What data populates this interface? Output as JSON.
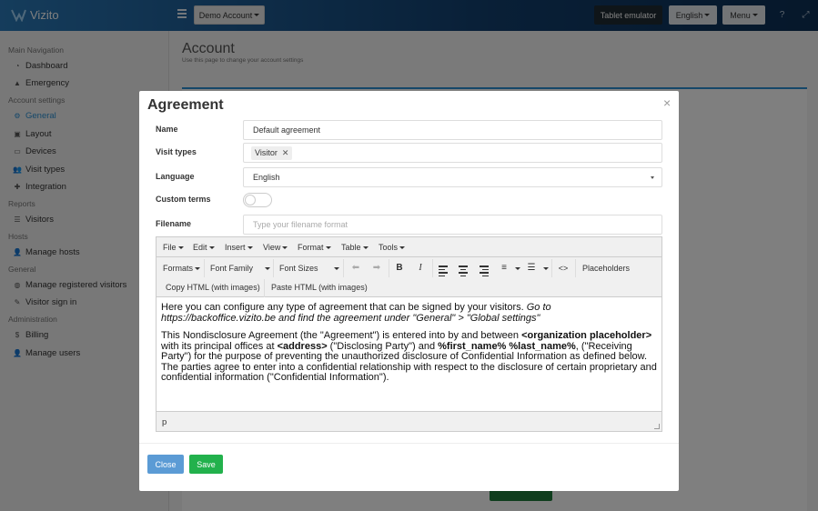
{
  "app": {
    "name": "Vizito"
  },
  "topbar": {
    "account_button": "Demo Account",
    "tablet_button": "Tablet emulator",
    "language_button": "English",
    "menu_button": "Menu"
  },
  "sidebar": {
    "sections": [
      {
        "title": "Main Navigation",
        "items": [
          {
            "label": "Dashboard",
            "icon": "dashboard-icon"
          },
          {
            "label": "Emergency",
            "icon": "warning-icon"
          }
        ]
      },
      {
        "title": "Account settings",
        "items": [
          {
            "label": "General",
            "icon": "gear-icon",
            "active": true
          },
          {
            "label": "Layout",
            "icon": "image-icon"
          },
          {
            "label": "Devices",
            "icon": "tablet-icon"
          },
          {
            "label": "Visit types",
            "icon": "users-icon"
          },
          {
            "label": "Integration",
            "icon": "puzzle-icon"
          }
        ]
      },
      {
        "title": "Reports",
        "items": [
          {
            "label": "Visitors",
            "icon": "list-icon"
          }
        ]
      },
      {
        "title": "Hosts",
        "items": [
          {
            "label": "Manage hosts",
            "icon": "user-plus-icon"
          }
        ]
      },
      {
        "title": "General",
        "items": [
          {
            "label": "Manage registered visitors",
            "icon": "globe-icon"
          },
          {
            "label": "Visitor sign in",
            "icon": "pen-icon"
          }
        ]
      },
      {
        "title": "Administration",
        "items": [
          {
            "label": "Billing",
            "icon": "dollar-icon"
          },
          {
            "label": "Manage users",
            "icon": "user-add-icon"
          }
        ]
      }
    ]
  },
  "page": {
    "title": "Account",
    "subtitle": "Use this page to change your account settings"
  },
  "modal": {
    "title": "Agreement",
    "close_glyph": "×",
    "fields": {
      "name_label": "Name",
      "name_value": "Default agreement",
      "visit_types_label": "Visit types",
      "visit_type_chip": "Visitor",
      "language_label": "Language",
      "language_value": "English",
      "custom_terms_label": "Custom terms",
      "custom_terms_on": false,
      "filename_label": "Filename",
      "filename_placeholder": "Type your filename format"
    },
    "editor": {
      "menus": [
        "File",
        "Edit",
        "Insert",
        "View",
        "Format",
        "Table",
        "Tools"
      ],
      "formats_label": "Formats",
      "font_family_label": "Font Family",
      "font_sizes_label": "Font Sizes",
      "placeholders_label": "Placeholders",
      "copy_html_label": "Copy HTML (with images)",
      "paste_html_label": "Paste HTML (with images)",
      "content": {
        "p1_normal": "Here you can configure any type of agreement that can be signed by your visitors. ",
        "p1_italic": "Go to https://backoffice.vizito.be and find the agreement under \"General\" > \"Global settings\"",
        "p2_a": "This Nondisclosure Agreement (the \"Agreement\") is entered into by and between ",
        "p2_b": "<organization placeholder>",
        "p2_c": " with its principal offices at ",
        "p2_d": "<address>",
        "p2_e": " (\"Disclosing Party\") and ",
        "p2_f": "%first_name% %last_name%",
        "p2_g": ", (\"Receiving Party\") for the purpose of preventing the unauthorized disclosure of Confidential Information as defined below. The parties agree to enter into a confidential relationship with respect to the disclosure of certain proprietary and confidential information (\"Confidential Information\")."
      },
      "status_path": "p"
    },
    "buttons": {
      "close": "Close",
      "save": "Save"
    }
  }
}
